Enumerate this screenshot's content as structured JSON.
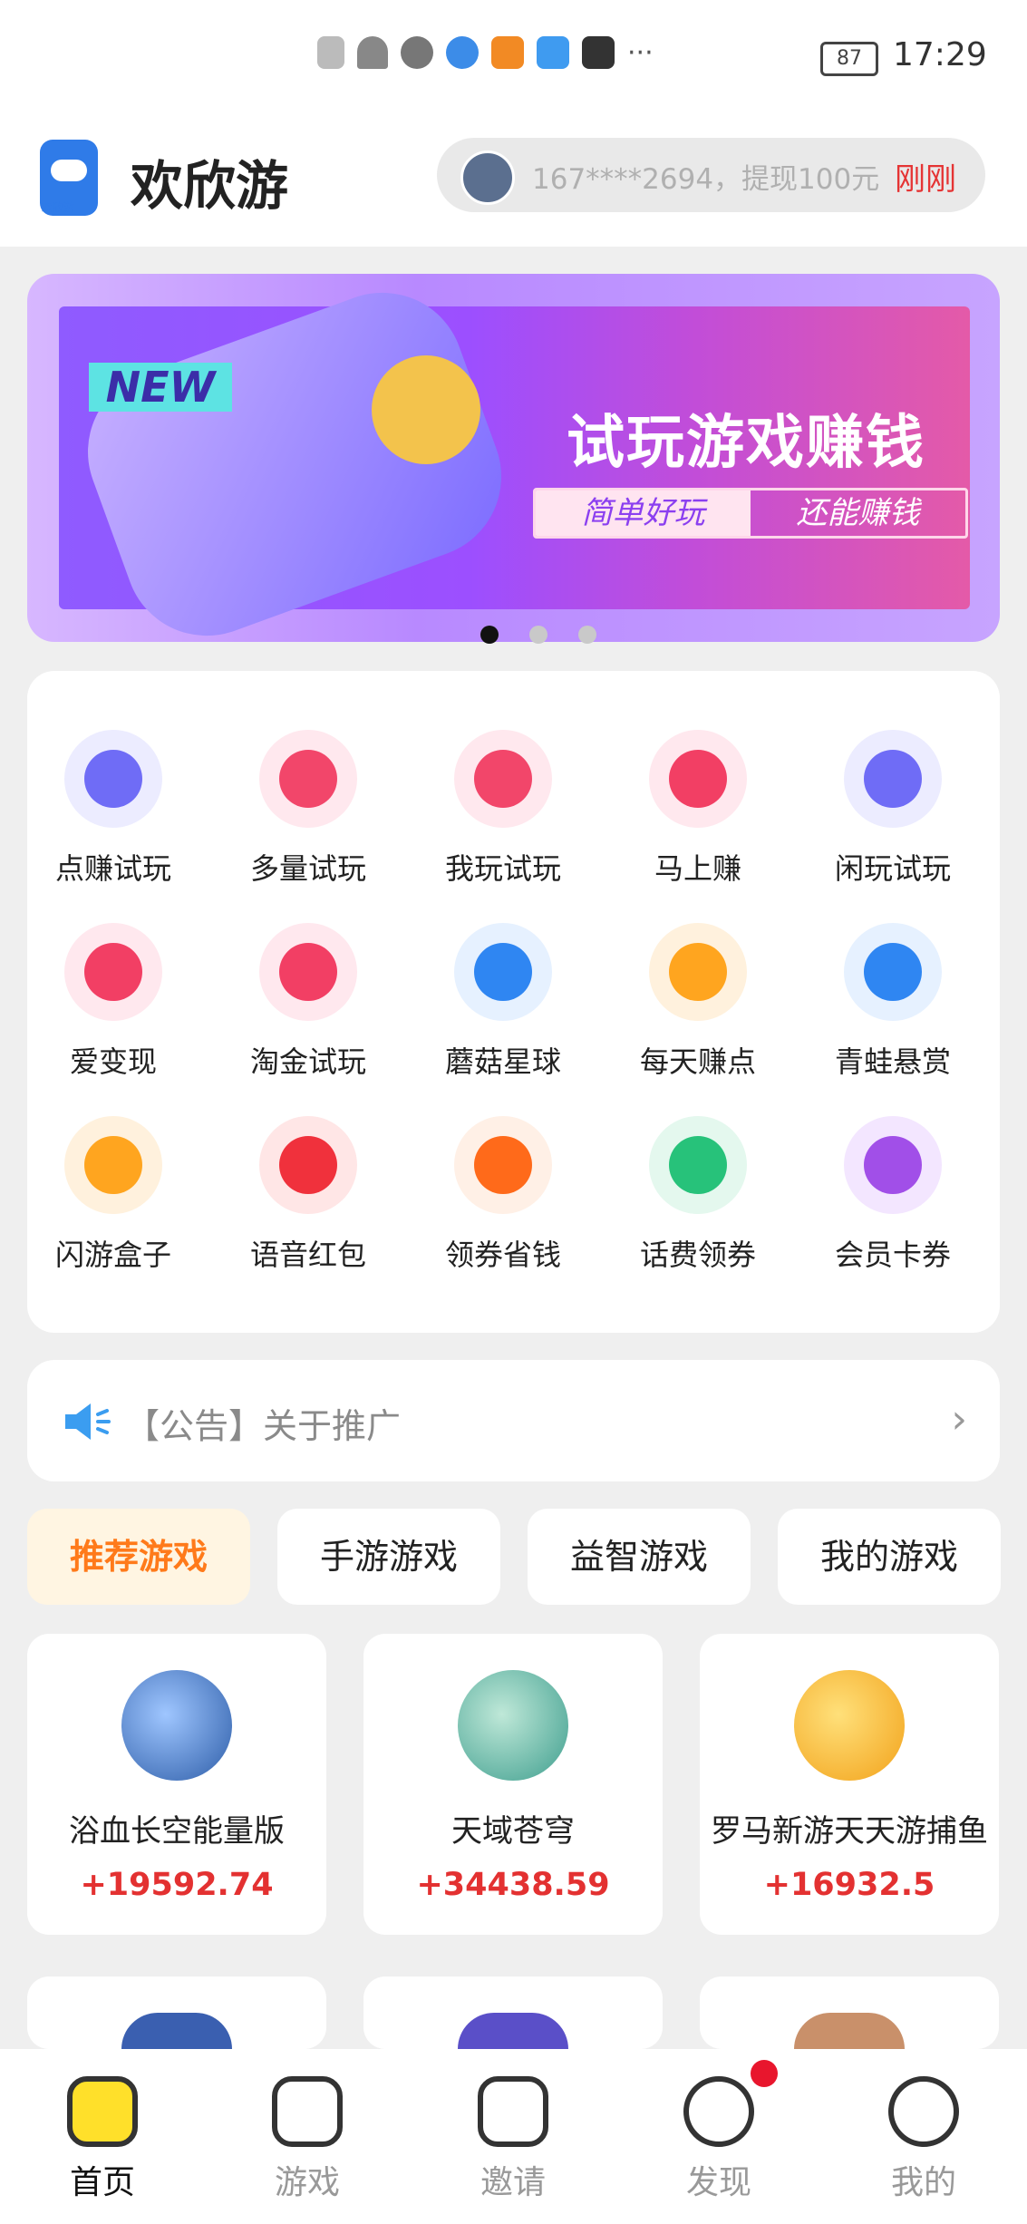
{
  "status": {
    "battery": "87",
    "time": "17:29"
  },
  "header": {
    "app_name": "欢欣游",
    "logo_text": "欢欣游",
    "ticker_text": "167****2694，提现100元",
    "ticker_time": "刚刚"
  },
  "banner": {
    "tag": "NEW",
    "title": "试玩游戏赚钱",
    "pill_left": "简单好玩",
    "pill_right": "还能赚钱",
    "page_count": 3,
    "active_page": 1
  },
  "grid": [
    {
      "label": "点赚试玩",
      "icon": "gamepad-icon",
      "color": "#6f6cf6",
      "bg": "#ececff"
    },
    {
      "label": "多量试玩",
      "icon": "game-controller-icon",
      "color": "#f2466a",
      "bg": "#ffe8ee"
    },
    {
      "label": "我玩试玩",
      "icon": "game-controller-icon",
      "color": "#f2466a",
      "bg": "#ffe8ee"
    },
    {
      "label": "马上赚",
      "icon": "pacman-icon",
      "color": "#f23f64",
      "bg": "#ffe8ee"
    },
    {
      "label": "闲玩试玩",
      "icon": "gamepad-icon",
      "color": "#6f6cf6",
      "bg": "#ececff"
    },
    {
      "label": "爱变现",
      "icon": "pacman-icon",
      "color": "#f23f64",
      "bg": "#ffe8ee"
    },
    {
      "label": "淘金试玩",
      "icon": "pacman-icon",
      "color": "#f23f64",
      "bg": "#ffe8ee"
    },
    {
      "label": "蘑菇星球",
      "icon": "search-bubble-icon",
      "color": "#2f86f2",
      "bg": "#e6f1ff"
    },
    {
      "label": "每天赚点",
      "icon": "money-bag-icon",
      "color": "#ffa51f",
      "bg": "#fff1dd"
    },
    {
      "label": "青蛙悬赏",
      "icon": "document-icon",
      "color": "#2f86f2",
      "bg": "#e6f1ff"
    },
    {
      "label": "闪游盒子",
      "icon": "money-bag-icon",
      "color": "#ffa51f",
      "bg": "#fff1dd"
    },
    {
      "label": "语音红包",
      "icon": "red-envelope-icon",
      "color": "#f0313c",
      "bg": "#ffe6e6"
    },
    {
      "label": "领券省钱",
      "icon": "taobao-icon",
      "color": "#ff6a1a",
      "bg": "#fff0e6"
    },
    {
      "label": "话费领券",
      "icon": "receipt-icon",
      "color": "#27c27a",
      "bg": "#e4f8ee"
    },
    {
      "label": "会员卡券",
      "icon": "diamond-icon",
      "color": "#a14fe8",
      "bg": "#f3e6ff"
    }
  ],
  "notice": {
    "text": "【公告】关于推广",
    "arrow": "›"
  },
  "tabs": [
    {
      "label": "推荐游戏",
      "active": true
    },
    {
      "label": "手游游戏",
      "active": false
    },
    {
      "label": "益智游戏",
      "active": false
    },
    {
      "label": "我的游戏",
      "active": false
    }
  ],
  "games": [
    {
      "name": "浴血长空能量版",
      "reward": "+19592.74",
      "color": "#2d5da8"
    },
    {
      "name": "天域苍穹",
      "reward": "+34438.59",
      "color": "#3e9e8e"
    },
    {
      "name": "罗马新游天天游捕鱼",
      "reward": "+16932.5",
      "color": "#f2a21a"
    }
  ],
  "nav": [
    {
      "label": "首页",
      "icon": "home-icon",
      "active": true
    },
    {
      "label": "游戏",
      "icon": "game-icon",
      "active": false
    },
    {
      "label": "邀请",
      "icon": "invite-icon",
      "active": false
    },
    {
      "label": "发现",
      "icon": "discover-icon",
      "active": false
    },
    {
      "label": "我的",
      "icon": "profile-icon",
      "active": false
    }
  ]
}
